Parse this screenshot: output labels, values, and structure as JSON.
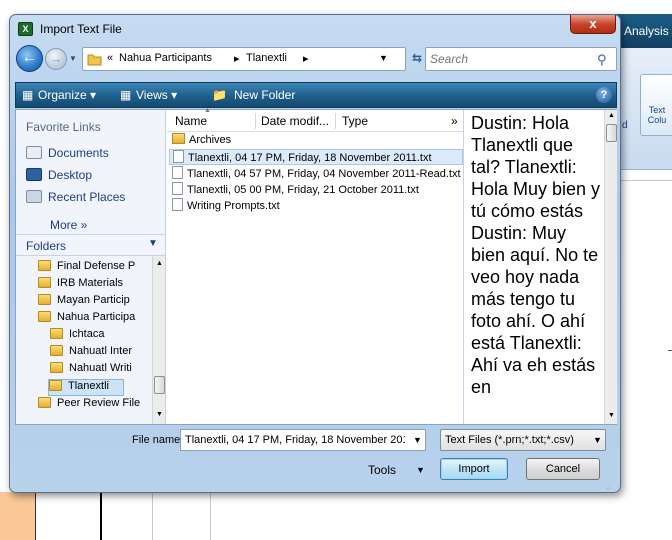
{
  "window": {
    "title": "Import Text File",
    "close_label": "x"
  },
  "background": {
    "app_title_fragment": "t Analysis",
    "ribbon_button_label": "Text Colu",
    "ribbon_letter": "d"
  },
  "nav": {
    "breadcrumb_lead": "«",
    "breadcrumb": [
      "Nahua Participants",
      "Tlanextli"
    ],
    "search_placeholder": "Search"
  },
  "toolbar": {
    "organize": "Organize",
    "views": "Views",
    "new_folder": "New Folder"
  },
  "sidebar": {
    "favorite_links_header": "Favorite Links",
    "favorites": [
      {
        "label": "Documents",
        "icon": "documents-icon"
      },
      {
        "label": "Desktop",
        "icon": "desktop-icon"
      },
      {
        "label": "Recent Places",
        "icon": "recent-places-icon"
      }
    ],
    "more_label": "More »",
    "folders_header": "Folders",
    "tree": [
      {
        "label": "Final Defense P",
        "indent": 1
      },
      {
        "label": "IRB Materials",
        "indent": 1
      },
      {
        "label": "Mayan Particip",
        "indent": 1
      },
      {
        "label": "Nahua Participa",
        "indent": 1
      },
      {
        "label": "Ichtaca",
        "indent": 2
      },
      {
        "label": "Nahuatl Inter",
        "indent": 2
      },
      {
        "label": "Nahuatl Writi",
        "indent": 2
      },
      {
        "label": "Tlanextli",
        "indent": 2,
        "selected": true
      },
      {
        "label": "Peer Review File",
        "indent": 1
      }
    ]
  },
  "filelist": {
    "columns": [
      "Name",
      "Date modif...",
      "Type",
      "»"
    ],
    "rows": [
      {
        "name": "Archives",
        "kind": "folder",
        "selected": false
      },
      {
        "name": "Tlanextli, 04 17 PM, Friday, 18 November 2011.txt",
        "kind": "file",
        "selected": true
      },
      {
        "name": "Tlanextli, 04 57 PM, Friday, 04 November 2011-Read.txt",
        "kind": "file",
        "selected": false
      },
      {
        "name": "Tlanextli, 05 00 PM, Friday, 21 October 2011.txt",
        "kind": "file",
        "selected": false
      },
      {
        "name": "Writing Prompts.txt",
        "kind": "file",
        "selected": false
      }
    ]
  },
  "preview": {
    "text": "Dustin: Hola Tlanextli que tal? Tlanextli: Hola Muy bien y tú cómo estás Dustin: Muy bien aquí. No te veo hoy nada más tengo tu foto ahí. O ahí está Tlanextli: Ahí va eh estás en"
  },
  "footer": {
    "file_name_label": "File name:",
    "file_name_value": "Tlanextli, 04 17 PM, Friday, 18 November 201",
    "file_type_value": "Text Files (*.prn;*.txt;*.csv)",
    "tools_label": "Tools",
    "import_label": "Import",
    "cancel_label": "Cancel"
  },
  "colors": {
    "toolbar": "#1e5e8a",
    "close_button": "#c7472b",
    "selection": "#dcebfc"
  }
}
